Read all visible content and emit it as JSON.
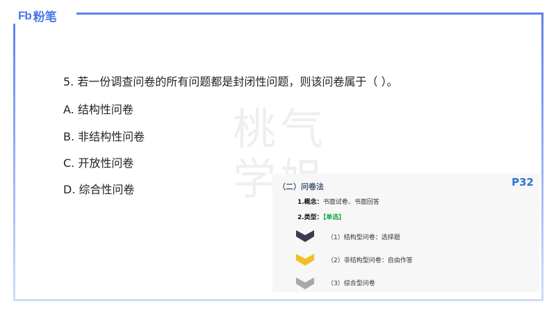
{
  "brand": {
    "logo_mark": "Fb",
    "logo_text": "粉笔"
  },
  "question": {
    "text": "5. 若一份调查问卷的所有问题都是封闭性问题，则该问卷属于（ ）。",
    "options": [
      "A. 结构性问卷",
      "B. 非结构性问卷",
      "C. 开放性问卷",
      "D. 综合性问卷"
    ]
  },
  "watermark": "桃气学姐",
  "card": {
    "title": "（二）问卷法",
    "page": "P32",
    "concept_label": "1.概念：",
    "concept_text": "书面试卷、书面回答",
    "type_label": "2.类型：",
    "type_tag": "【单选】",
    "items": [
      {
        "text": "（1）结构型问卷：选择题",
        "color": "#3a3d4e"
      },
      {
        "text": "（2）非结构型问卷：自由作答",
        "color": "#f2be22"
      },
      {
        "text": "（3）综合型问卷",
        "color": "#a8a8a8"
      }
    ]
  }
}
